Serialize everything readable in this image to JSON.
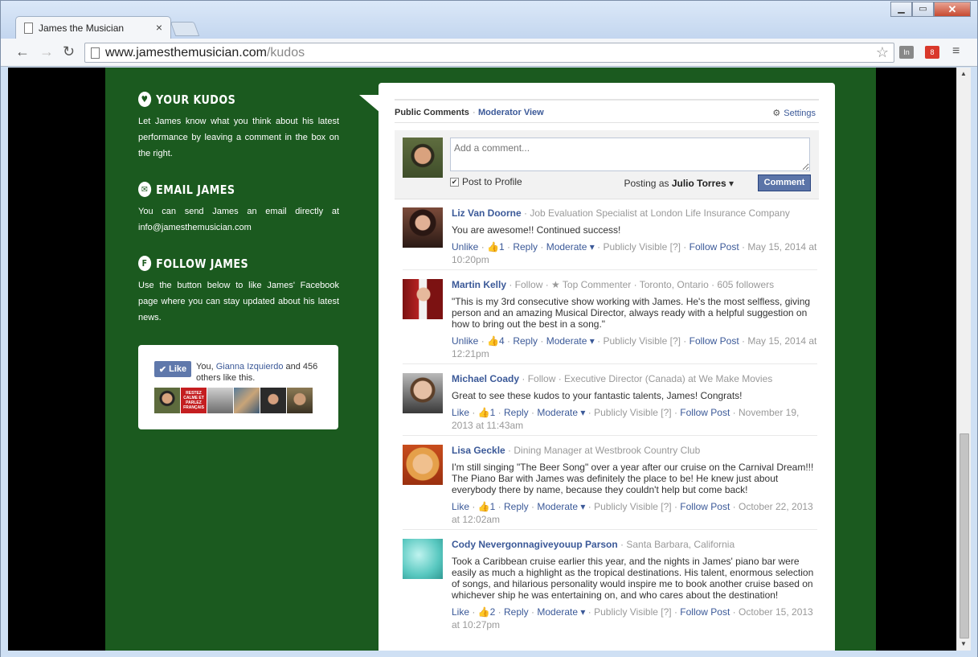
{
  "browser": {
    "tab_title": "James the Musician",
    "tab_close": "×",
    "url_host": "www.jamesthemusician.com",
    "url_path": "/kudos",
    "ext1": "In",
    "ext2": "8"
  },
  "sidebar": {
    "kudos": {
      "title": "Your Kudos",
      "body": "Let James know what you think about his latest performance by leaving a comment in the box on the right."
    },
    "email": {
      "title": "Email James",
      "body": "You can send James an email directly at info@jamesthemusician.com"
    },
    "follow": {
      "title": "Follow James",
      "body": "Use the button below to like James' Facebook page where you can stay updated about his latest news."
    },
    "like_box": {
      "button": "Like",
      "text_prefix": "You, ",
      "friend": "Gianna Izquierdo",
      "text_suffix": " and 456 others like this.",
      "face2_text": "RESTEZ CALME ET PARLEZ FRANÇAIS"
    }
  },
  "comments_panel": {
    "tab_public": "Public Comments",
    "tab_moderator": "Moderator View",
    "settings": "Settings",
    "input_placeholder": "Add a comment...",
    "post_to_profile": "Post to Profile",
    "posting_as_label": "Posting as ",
    "posting_as_name": "Julio Torres",
    "comment_button": "Comment",
    "comments": [
      {
        "author": "Liz Van Doorne",
        "meta": " · Job Evaluation Specialist at London Life Insurance Company",
        "text": "You are awesome!! Continued success!",
        "like": "Unlike",
        "likes": "1",
        "date": "May 15, 2014 at 10:20pm"
      },
      {
        "author": "Martin Kelly",
        "meta": " · Follow · ★ Top Commenter · Toronto, Ontario · 605 followers",
        "text": "\"This is my 3rd consecutive show working with James. He's the most selfless, giving person and an amazing Musical Director, always ready with a helpful suggestion on how to bring out the best in a song.\"",
        "like": "Unlike",
        "likes": "4",
        "date": "May 15, 2014 at 12:21pm"
      },
      {
        "author": "Michael Coady",
        "meta": " · Follow · Executive Director (Canada) at We Make Movies",
        "text": "Great to see these kudos to your fantastic talents, James! Congrats!",
        "like": "Like",
        "likes": "1",
        "date": "November 19, 2013 at 11:43am"
      },
      {
        "author": "Lisa Geckle",
        "meta": " · Dining Manager at Westbrook Country Club",
        "text": "I'm still singing \"The Beer Song\" over a year after our cruise on the Carnival Dream!!! The Piano Bar with James was definitely the place to be! He knew just about everybody there by name, because they couldn't help but come back!",
        "like": "Like",
        "likes": "1",
        "date": "October 22, 2013 at 12:02am"
      },
      {
        "author": "Cody Nevergonnagiveyouup Parson",
        "meta": " · Santa Barbara, California",
        "text": "Took a Caribbean cruise earlier this year, and the nights in James' piano bar were easily as much a highlight as the tropical destinations. His talent, enormous selection of songs, and hilarious personality would inspire me to book another cruise based on whichever ship he was entertaining on, and who cares about the destination!",
        "like": "Like",
        "likes": "2",
        "date": "October 15, 2013 at 10:27pm"
      }
    ],
    "action_reply": "Reply",
    "action_moderate": "Moderate",
    "action_visibility": "Publicly Visible",
    "action_help": "[?]",
    "action_follow_post": "Follow Post"
  }
}
